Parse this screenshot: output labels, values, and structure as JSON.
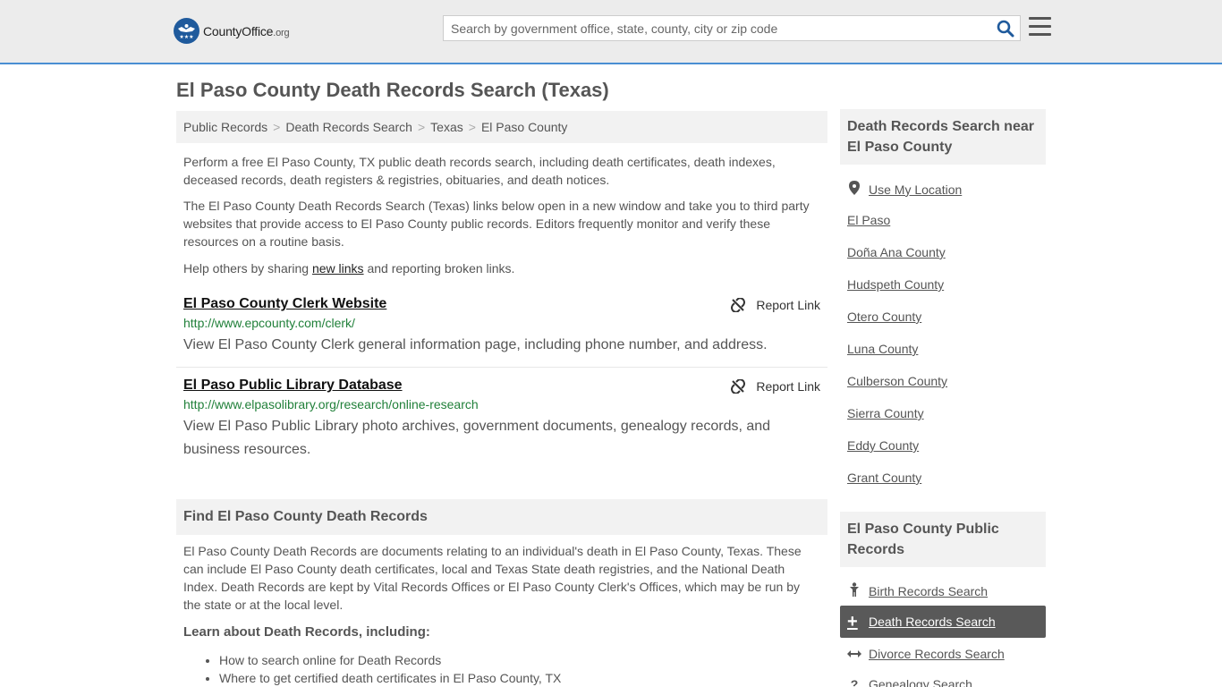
{
  "header": {
    "logo_brand": "CountyOffice",
    "logo_tld": ".org",
    "search_placeholder": "Search by government office, state, county, city or zip code"
  },
  "page_title": "El Paso County Death Records Search (Texas)",
  "breadcrumb": [
    "Public Records",
    "Death Records Search",
    "Texas",
    "El Paso County"
  ],
  "intro": {
    "p1": "Perform a free El Paso County, TX public death records search, including death certificates, death indexes, deceased records, death registers & registries, obituaries, and death notices.",
    "p2": "The El Paso County Death Records Search (Texas) links below open in a new window and take you to third party websites that provide access to El Paso County public records. Editors frequently monitor and verify these resources on a routine basis.",
    "p3_before": "Help others by sharing ",
    "p3_link": "new links",
    "p3_after": " and reporting broken links."
  },
  "results": [
    {
      "title": "El Paso County Clerk Website",
      "url": "http://www.epcounty.com/clerk/",
      "desc": "View El Paso County Clerk general information page, including phone number, and address.",
      "report": "Report Link"
    },
    {
      "title": "El Paso Public Library Database",
      "url": "http://www.elpasolibrary.org/research/online-research",
      "desc": "View El Paso Public Library photo archives, government documents, genealogy records, and business resources.",
      "report": "Report Link"
    }
  ],
  "find_section": {
    "title": "Find El Paso County Death Records",
    "body": "El Paso County Death Records are documents relating to an individual's death in El Paso County, Texas. These can include El Paso County death certificates, local and Texas State death registries, and the National Death Index. Death Records are kept by Vital Records Offices or El Paso County Clerk's Offices, which may be run by the state or at the local level.",
    "learn_title": "Learn about Death Records, including:",
    "bullets": [
      "How to search online for Death Records",
      "Where to get certified death certificates in El Paso County, TX"
    ]
  },
  "sidebar": {
    "nearby_title": "Death Records Search near El Paso County",
    "use_location": "Use My Location",
    "nearby": [
      "El Paso",
      "Doña Ana County",
      "Hudspeth County",
      "Otero County",
      "Luna County",
      "Culberson County",
      "Sierra County",
      "Eddy County",
      "Grant County"
    ],
    "public_title": "El Paso County Public Records",
    "public_links": [
      {
        "label": "Birth Records Search",
        "icon": "person-icon"
      },
      {
        "label": "Death Records Search",
        "icon": "cross-icon"
      },
      {
        "label": "Divorce Records Search",
        "icon": "arrows-icon"
      },
      {
        "label": "Genealogy Search",
        "icon": "question-icon"
      }
    ]
  },
  "colors": {
    "accent": "#4a8fd3",
    "url_green": "#21803a",
    "active_bg": "#595959"
  }
}
